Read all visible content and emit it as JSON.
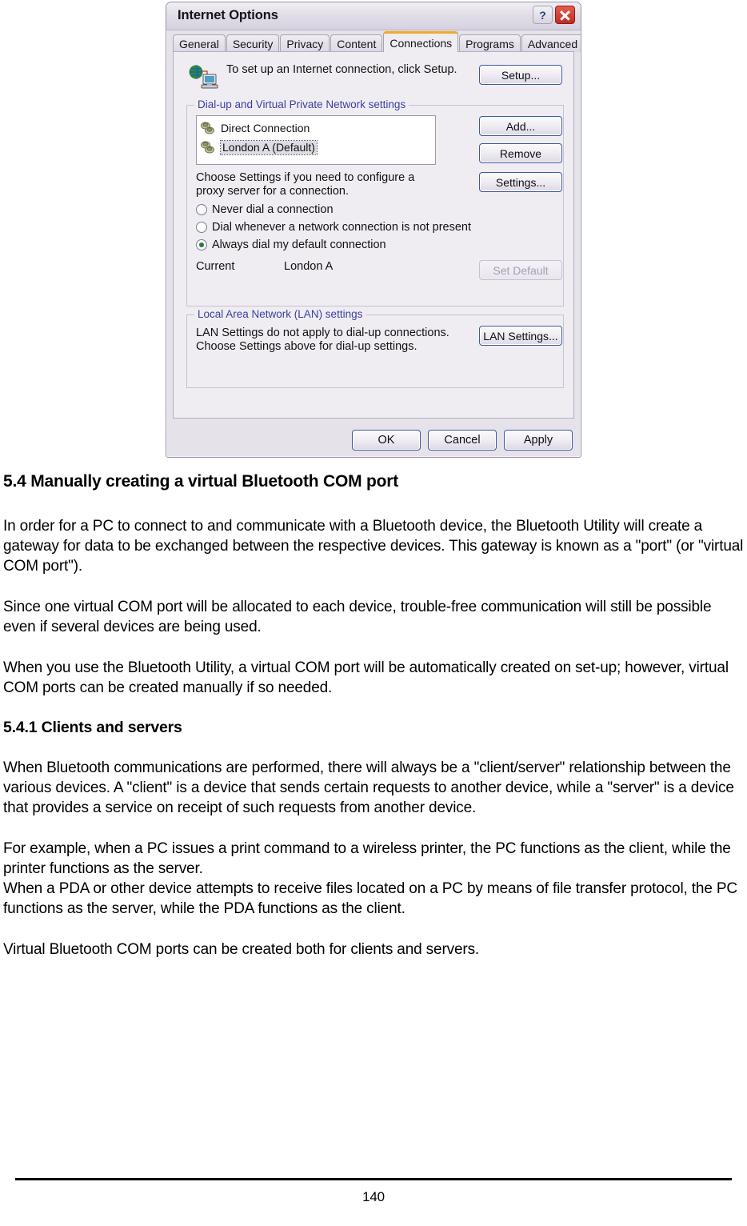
{
  "dialog": {
    "title": "Internet Options",
    "help_button": "?",
    "close_button": "close-icon",
    "tabs": [
      {
        "label": "General",
        "active": false
      },
      {
        "label": "Security",
        "active": false
      },
      {
        "label": "Privacy",
        "active": false
      },
      {
        "label": "Content",
        "active": false
      },
      {
        "label": "Connections",
        "active": true
      },
      {
        "label": "Programs",
        "active": false
      },
      {
        "label": "Advanced",
        "active": false
      }
    ],
    "setup_section": {
      "icon": "globe-computer-icon",
      "description": "To set up an Internet connection, click Setup.",
      "button_label": "Setup..."
    },
    "dialup_group": {
      "legend": "Dial-up and Virtual Private Network settings",
      "connections": [
        {
          "name": "Direct Connection",
          "icon": "network-connection-icon",
          "focused": false
        },
        {
          "name": "London A (Default)",
          "icon": "network-connection-icon",
          "focused": true
        }
      ],
      "buttons": {
        "add": "Add...",
        "remove": "Remove",
        "settings": "Settings...",
        "set_default": "Set Default"
      },
      "proxy_note": "Choose Settings if you need to configure a proxy server for a connection.",
      "dial_options": [
        {
          "label": "Never dial a connection",
          "selected": false
        },
        {
          "label": "Dial whenever a network connection is not present",
          "selected": false
        },
        {
          "label": "Always dial my default connection",
          "selected": true
        }
      ],
      "current_label": "Current",
      "current_value": "London A"
    },
    "lan_group": {
      "legend": "Local Area Network (LAN) settings",
      "note": "LAN Settings do not apply to dial-up connections. Choose Settings above for dial-up settings.",
      "button_label": "LAN Settings..."
    },
    "footer_buttons": {
      "ok": "OK",
      "cancel": "Cancel",
      "apply": "Apply"
    },
    "colors": {
      "active_tab_accent": "#f0a92a",
      "legend_text": "#3b3fa0",
      "dialog_face": "#efedf2",
      "button_border": "#3c5a9a",
      "close_button": "#c32b20",
      "radio_dot": "#2d7a2d"
    }
  },
  "document": {
    "heading": "5.4  Manually creating a virtual Bluetooth COM port",
    "paragraph_1": "In order for a PC to connect to and communicate with a Bluetooth device, the Bluetooth Utility will create a gateway for data to be exchanged between the respective devices. This gateway is known as a \"port\" (or \"virtual COM port\").",
    "paragraph_2": "Since one virtual COM port will be allocated to each device, trouble-free communication will still be possible even if several devices are being used.",
    "paragraph_3": "When you use the Bluetooth Utility, a virtual COM port will be automatically created on set-up; however, virtual COM ports can be created manually if so needed.",
    "subheading": "5.4.1    Clients and servers",
    "paragraph_4": "When Bluetooth communications are performed, there will always be a \"client/server\" relationship between the various devices. A \"client\" is a device that sends certain requests to another device, while a \"server\" is a device that provides a service on receipt of such requests from another device.",
    "paragraph_5": "For example, when a PC issues a print command to a wireless printer, the PC functions as the client, while the printer functions as the server.",
    "paragraph_6": "When a PDA or other device attempts to receive files located on a PC by means of file transfer protocol, the PC functions as the server, while the PDA functions as the client.",
    "paragraph_7": "Virtual Bluetooth COM ports can be created both for clients and servers.",
    "page_number": "140"
  }
}
